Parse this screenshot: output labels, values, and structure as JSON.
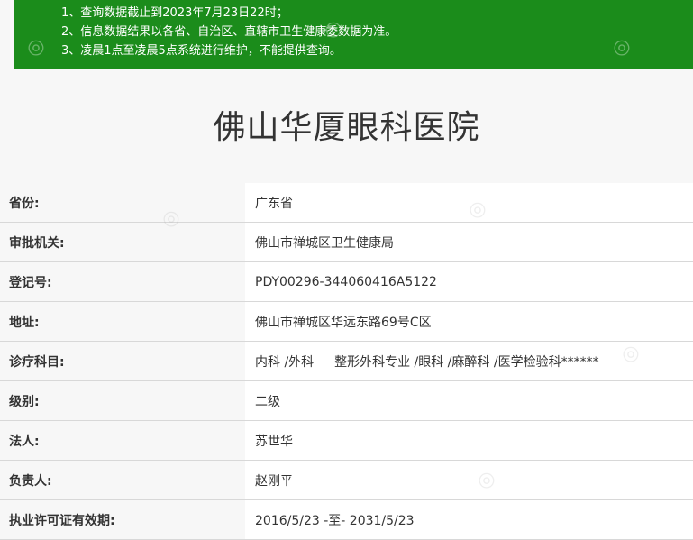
{
  "notice": {
    "lines": [
      "1、查询数据截止到2023年7月23日22时；",
      "2、信息数据结果以各省、自治区、直辖市卫生健康委数据为准。",
      "3、凌晨1点至凌晨5点系统进行维护，不能提供查询。"
    ]
  },
  "hospital": {
    "name": "佛山华厦眼科医院"
  },
  "fields": [
    {
      "label": "省份:",
      "value": "广东省"
    },
    {
      "label": "审批机关:",
      "value": "佛山市禅城区卫生健康局"
    },
    {
      "label": "登记号:",
      "value": "PDY00296-344060416A5122"
    },
    {
      "label": "地址:",
      "value": "佛山市禅城区华远东路69号C区"
    },
    {
      "label": "诊疗科目:",
      "value": "内科 /外科 ｜ 整形外科专业 /眼科 /麻醉科 /医学检验科******"
    },
    {
      "label": "级别:",
      "value": "二级"
    },
    {
      "label": "法人:",
      "value": "苏世华"
    },
    {
      "label": "负责人:",
      "value": "赵刚平"
    },
    {
      "label": "执业许可证有效期:",
      "value": "2016/5/23 -至- 2031/5/23"
    }
  ]
}
